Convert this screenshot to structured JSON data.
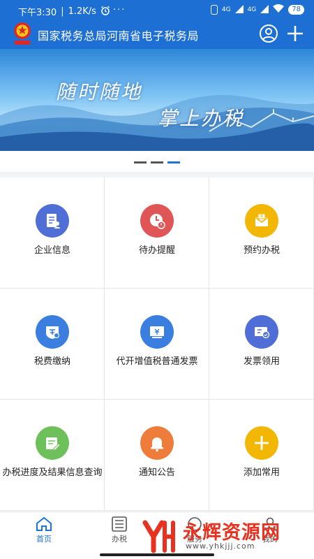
{
  "status_bar": {
    "time": "下午3:30",
    "speed": "1.2K/s",
    "more": "···",
    "network_1": "4G",
    "network_2": "4G",
    "battery": "78"
  },
  "header": {
    "title": "国家税务总局河南省电子税务局",
    "emblem_icon": "tax-bureau-emblem",
    "user_icon": "user-icon",
    "add_icon": "plus-icon",
    "color": "#1e6fd3"
  },
  "banner": {
    "slogan_line1": "随时随地",
    "slogan_line2": "掌上办税"
  },
  "pager": {
    "count": 3,
    "active_index": 2
  },
  "grid": {
    "items": [
      {
        "label": "企业信息",
        "icon": "enterprise-info-icon",
        "color": "#4f6fd6"
      },
      {
        "label": "待办提醒",
        "icon": "clock-reminder-icon",
        "color": "#e05656"
      },
      {
        "label": "预约办税",
        "icon": "appointment-icon",
        "color": "#f2b705"
      },
      {
        "label": "税费缴纳",
        "icon": "tax-payment-icon",
        "color": "#3a7fe0"
      },
      {
        "label": "代开增值税普通发票",
        "icon": "invoice-issue-icon",
        "color": "#3a7fe0"
      },
      {
        "label": "发票领用",
        "icon": "invoice-receive-icon",
        "color": "#4f6fd6"
      },
      {
        "label": "办税进度及结果信息查询",
        "icon": "progress-query-icon",
        "color": "#6ec05a"
      },
      {
        "label": "通知公告",
        "icon": "bell-icon",
        "color": "#ee7d3c"
      },
      {
        "label": "添加常用",
        "icon": "plus-icon",
        "color": "#f2b705"
      }
    ]
  },
  "bottom_nav": {
    "tabs": [
      {
        "label": "首页",
        "icon": "home-icon",
        "active": true
      },
      {
        "label": "办税",
        "icon": "list-icon",
        "active": false
      },
      {
        "label": "服务",
        "icon": "service-icon",
        "active": false
      },
      {
        "label": "我的",
        "icon": "profile-icon",
        "active": false
      }
    ]
  },
  "watermark": {
    "text": "永辉资源网",
    "url": "www.yhkjjj.com"
  }
}
